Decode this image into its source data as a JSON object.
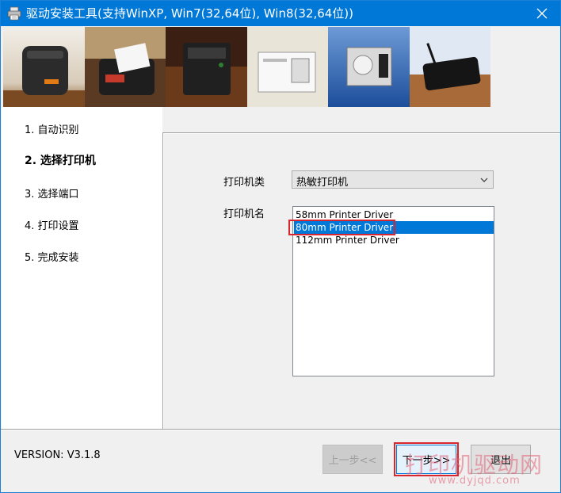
{
  "window": {
    "title": "驱动安装工具(支持WinXP, Win7(32,64位), Win8(32,64位))"
  },
  "banner": {
    "images": [
      "printer-photo-1",
      "printer-photo-2",
      "printer-photo-3",
      "printer-photo-4",
      "printer-photo-5",
      "printer-photo-6"
    ]
  },
  "steps": [
    {
      "label": "1. 自动识别"
    },
    {
      "label": "2. 选择打印机"
    },
    {
      "label": "3. 选择端口"
    },
    {
      "label": "4. 打印设置"
    },
    {
      "label": "5. 完成安装"
    }
  ],
  "form": {
    "printer_type_label": "打印机类",
    "printer_type_value": "热敏打印机",
    "printer_name_label": "打印机名",
    "printer_list": [
      {
        "label": "58mm Printer Driver"
      },
      {
        "label": "80mm Printer Driver"
      },
      {
        "label": "112mm Printer Driver"
      }
    ]
  },
  "footer": {
    "version": "VERSION: V3.1.8",
    "back_label": "上一步<<",
    "next_label": "下一步>>",
    "exit_label": "退出"
  },
  "watermark": {
    "text": "打印机驱动网",
    "url": "www.dyjqd.com"
  },
  "colors": {
    "titlebar": "#0078d7",
    "selection": "#0078d7",
    "highlight_box": "#d9262e"
  }
}
